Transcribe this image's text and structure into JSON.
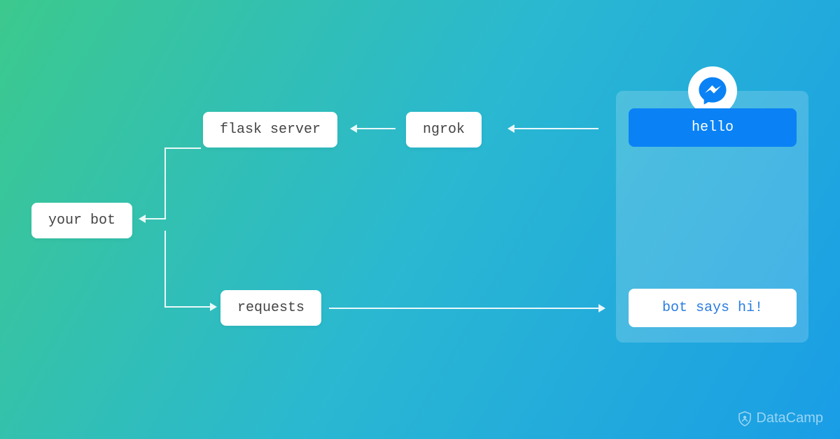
{
  "nodes": {
    "your_bot": "your bot",
    "flask_server": "flask server",
    "ngrok": "ngrok",
    "requests": "requests"
  },
  "chat": {
    "incoming": "hello",
    "outgoing": "bot says hi!"
  },
  "brand": "DataCamp"
}
